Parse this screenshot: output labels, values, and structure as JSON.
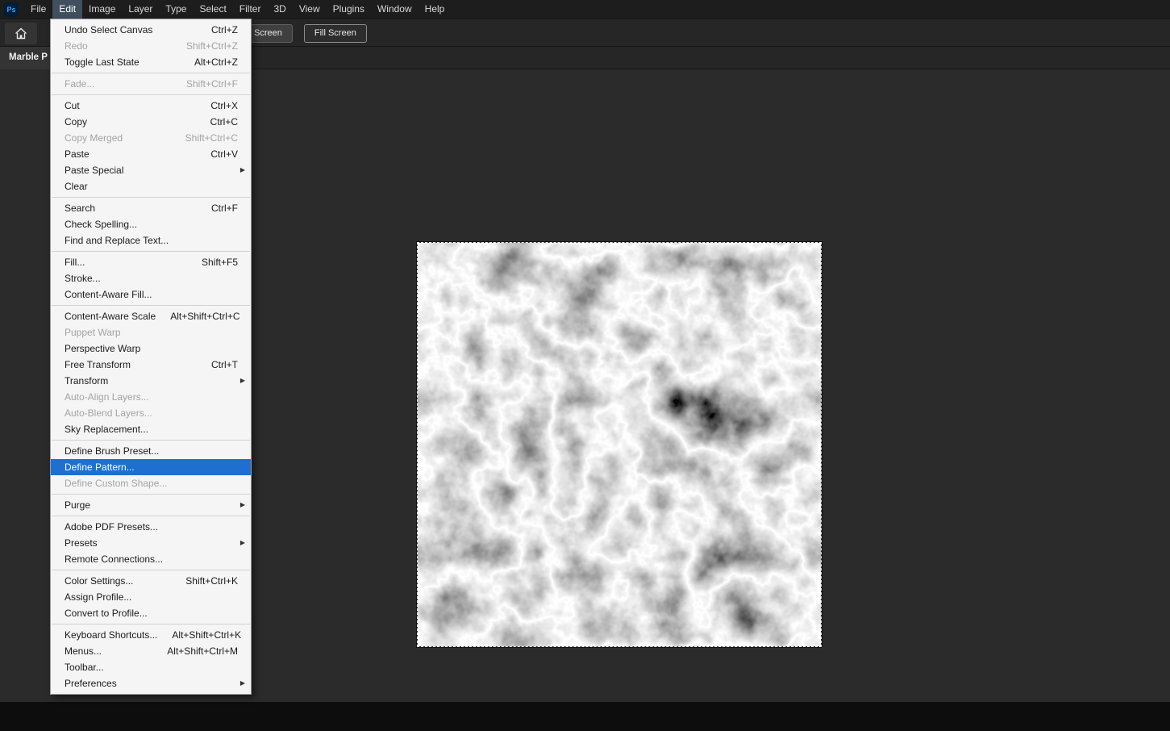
{
  "app": {
    "logo": "Ps"
  },
  "colors": {
    "highlight": "#1f6fd0",
    "logo_bg": "#001e36",
    "logo_text": "#31a8ff",
    "menubar_active_bg": "#41505e"
  },
  "icons": {
    "submenu_arrow": "▶"
  },
  "menubar": {
    "items": [
      {
        "label": "File"
      },
      {
        "label": "Edit",
        "active": true
      },
      {
        "label": "Image"
      },
      {
        "label": "Layer"
      },
      {
        "label": "Type"
      },
      {
        "label": "Select"
      },
      {
        "label": "Filter"
      },
      {
        "label": "3D"
      },
      {
        "label": "View"
      },
      {
        "label": "Plugins"
      },
      {
        "label": "Window"
      },
      {
        "label": "Help"
      }
    ]
  },
  "options_bar": {
    "buttons": [
      {
        "label": "Screen"
      },
      {
        "label": "Fill Screen"
      }
    ]
  },
  "document_tab": {
    "title": "Marble P"
  },
  "edit_menu": {
    "groups": [
      [
        {
          "label": "Undo Select Canvas",
          "shortcut": "Ctrl+Z"
        },
        {
          "label": "Redo",
          "shortcut": "Shift+Ctrl+Z",
          "disabled": true
        },
        {
          "label": "Toggle Last State",
          "shortcut": "Alt+Ctrl+Z"
        }
      ],
      [
        {
          "label": "Fade...",
          "shortcut": "Shift+Ctrl+F",
          "disabled": true
        }
      ],
      [
        {
          "label": "Cut",
          "shortcut": "Ctrl+X"
        },
        {
          "label": "Copy",
          "shortcut": "Ctrl+C"
        },
        {
          "label": "Copy Merged",
          "shortcut": "Shift+Ctrl+C",
          "disabled": true
        },
        {
          "label": "Paste",
          "shortcut": "Ctrl+V"
        },
        {
          "label": "Paste Special",
          "submenu": true
        },
        {
          "label": "Clear"
        }
      ],
      [
        {
          "label": "Search",
          "shortcut": "Ctrl+F"
        },
        {
          "label": "Check Spelling..."
        },
        {
          "label": "Find and Replace Text..."
        }
      ],
      [
        {
          "label": "Fill...",
          "shortcut": "Shift+F5"
        },
        {
          "label": "Stroke..."
        },
        {
          "label": "Content-Aware Fill..."
        }
      ],
      [
        {
          "label": "Content-Aware Scale",
          "shortcut": "Alt+Shift+Ctrl+C"
        },
        {
          "label": "Puppet Warp",
          "disabled": true
        },
        {
          "label": "Perspective Warp"
        },
        {
          "label": "Free Transform",
          "shortcut": "Ctrl+T"
        },
        {
          "label": "Transform",
          "submenu": true
        },
        {
          "label": "Auto-Align Layers...",
          "disabled": true
        },
        {
          "label": "Auto-Blend Layers...",
          "disabled": true
        },
        {
          "label": "Sky Replacement..."
        }
      ],
      [
        {
          "label": "Define Brush Preset..."
        },
        {
          "label": "Define Pattern...",
          "highlighted": true
        },
        {
          "label": "Define Custom Shape...",
          "disabled": true
        }
      ],
      [
        {
          "label": "Purge",
          "submenu": true
        }
      ],
      [
        {
          "label": "Adobe PDF Presets..."
        },
        {
          "label": "Presets",
          "submenu": true
        },
        {
          "label": "Remote Connections..."
        }
      ],
      [
        {
          "label": "Color Settings...",
          "shortcut": "Shift+Ctrl+K"
        },
        {
          "label": "Assign Profile..."
        },
        {
          "label": "Convert to Profile..."
        }
      ],
      [
        {
          "label": "Keyboard Shortcuts...",
          "shortcut": "Alt+Shift+Ctrl+K"
        },
        {
          "label": "Menus...",
          "shortcut": "Alt+Shift+Ctrl+M"
        },
        {
          "label": "Toolbar..."
        },
        {
          "label": "Preferences",
          "submenu": true
        }
      ]
    ]
  }
}
